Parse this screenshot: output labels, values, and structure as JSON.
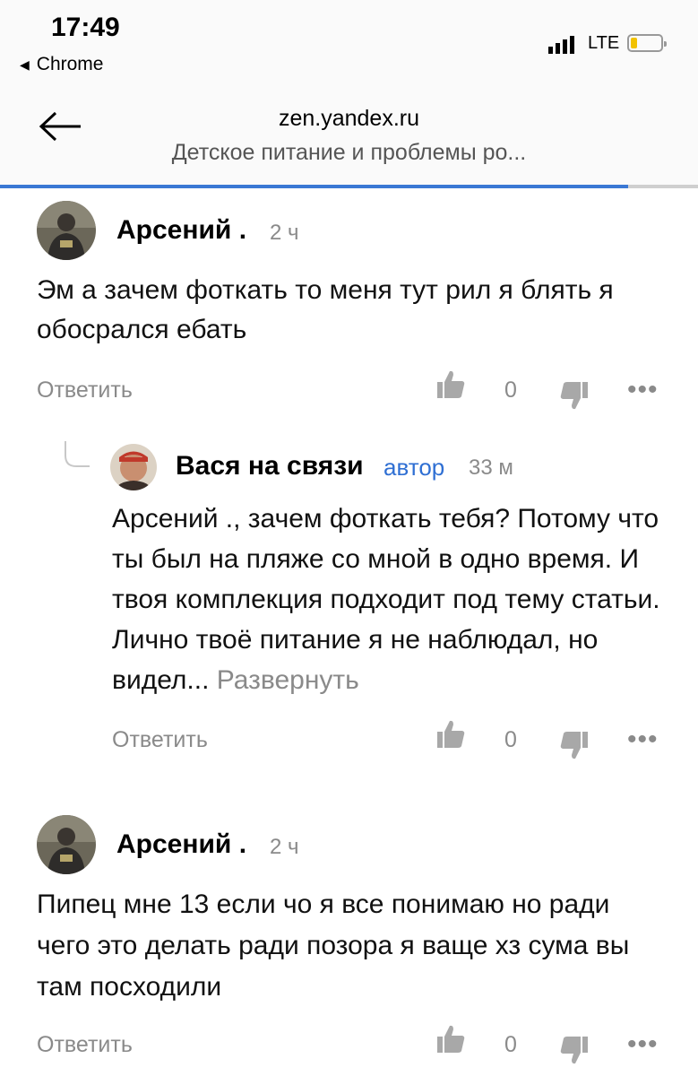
{
  "status_bar": {
    "time": "17:49",
    "back_app": "Chrome",
    "network": "LTE"
  },
  "header": {
    "domain": "zen.yandex.ru",
    "title": "Детское питание и проблемы ро..."
  },
  "comments": [
    {
      "author": "Арсений .",
      "time": "2 ч",
      "text": "Эм а зачем фоткать то меня тут рил я блять я обосрался ебать",
      "reply_label": "Ответить",
      "likes": "0"
    },
    {
      "author": "Вася на связи",
      "role": "автор",
      "time": "33 м",
      "text": "Арсений ., зачем фоткать тебя? Потому что ты был на пляже со мной в одно время. И твоя комплекция подходит под тему статьи. Лично твоё питание я не наблюдал, но видел...",
      "expand_label": "Развернуть",
      "reply_label": "Ответить",
      "likes": "0"
    },
    {
      "author": "Арсений .",
      "time": "2 ч",
      "text": "Пипец мне 13 если чо я все понимаю но ради чего это делать ради позора я ваще хз сума вы там посходили",
      "reply_label": "Ответить",
      "likes": "0"
    }
  ],
  "icons": {
    "more": "more-dots-icon",
    "like": "thumbs-up-icon",
    "dislike": "thumbs-down-icon",
    "back": "arrow-left-icon"
  },
  "colors": {
    "accent": "#2f6fd3",
    "progress": "#3a78d4",
    "muted": "#8a8a8a"
  },
  "progress": 0.9
}
